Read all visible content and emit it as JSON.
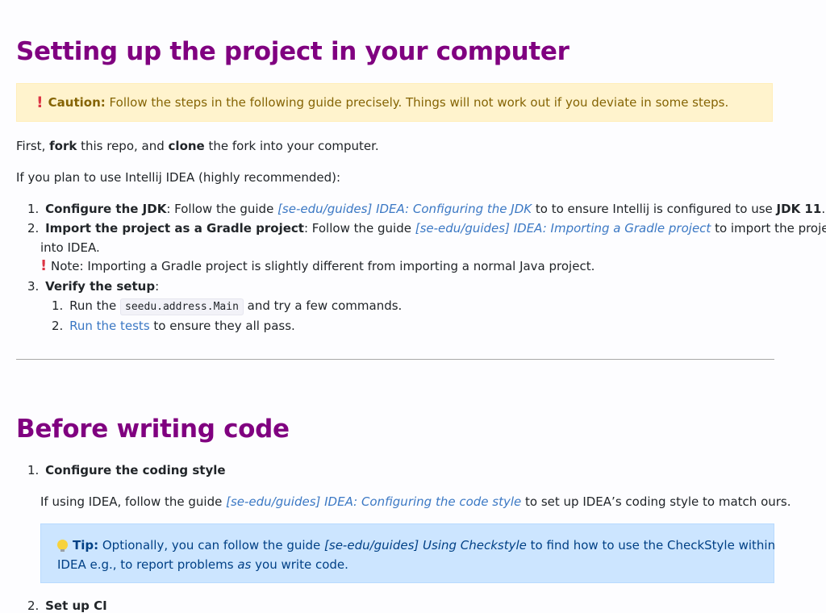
{
  "setup": {
    "title": "Setting up the project in your computer",
    "caution": {
      "label": "Caution:",
      "text": " Follow the steps in the following guide precisely. Things will not work out if you deviate in some steps."
    },
    "p1": {
      "a": "First, ",
      "b": "fork",
      "c": " this repo, and ",
      "d": "clone",
      "e": " the fork into your computer."
    },
    "p2": "If you plan to use Intellij IDEA (highly recommended):",
    "step1": {
      "num": "1.",
      "bold": "Configure the JDK",
      "text1": ": Follow the guide ",
      "link": "[se-edu/guides] IDEA: Configuring the JDK",
      "text2": " to to ensure Intellij is configured to use ",
      "bold2": "JDK 11",
      "text3": "."
    },
    "step2": {
      "num": "2.",
      "bold": "Import the project as a Gradle project",
      "text1": ": Follow the guide ",
      "link": "[se-edu/guides] IDEA: Importing a Gradle project",
      "text2": " to import the project",
      "text3": "into IDEA.",
      "note": " Note: Importing a Gradle project is slightly different from importing a normal Java project."
    },
    "step3": {
      "num": "3.",
      "bold": "Verify the setup",
      "colon": ":",
      "sub1": {
        "num": "1.",
        "a": "Run the ",
        "code": "seedu.address.Main",
        "b": " and try a few commands."
      },
      "sub2": {
        "num": "2.",
        "link": "Run the tests",
        "b": " to ensure they all pass."
      }
    }
  },
  "before": {
    "title": "Before writing code",
    "item1": {
      "num": "1.",
      "bold": "Configure the coding style",
      "text1": "If using IDEA, follow the guide ",
      "link": "[se-edu/guides] IDEA: Configuring the code style",
      "text2": " to set up IDEA’s coding style to match ours."
    },
    "tip": {
      "label": "Tip:",
      "text1": " Optionally, you can follow the guide ",
      "link": "[se-edu/guides] Using Checkstyle",
      "text2": " to find how to use the CheckStyle within",
      "text3": "IDEA e.g., to report problems ",
      "em": "as",
      "text4": " you write code."
    },
    "item2": {
      "num": "2.",
      "bold": "Set up CI"
    }
  }
}
